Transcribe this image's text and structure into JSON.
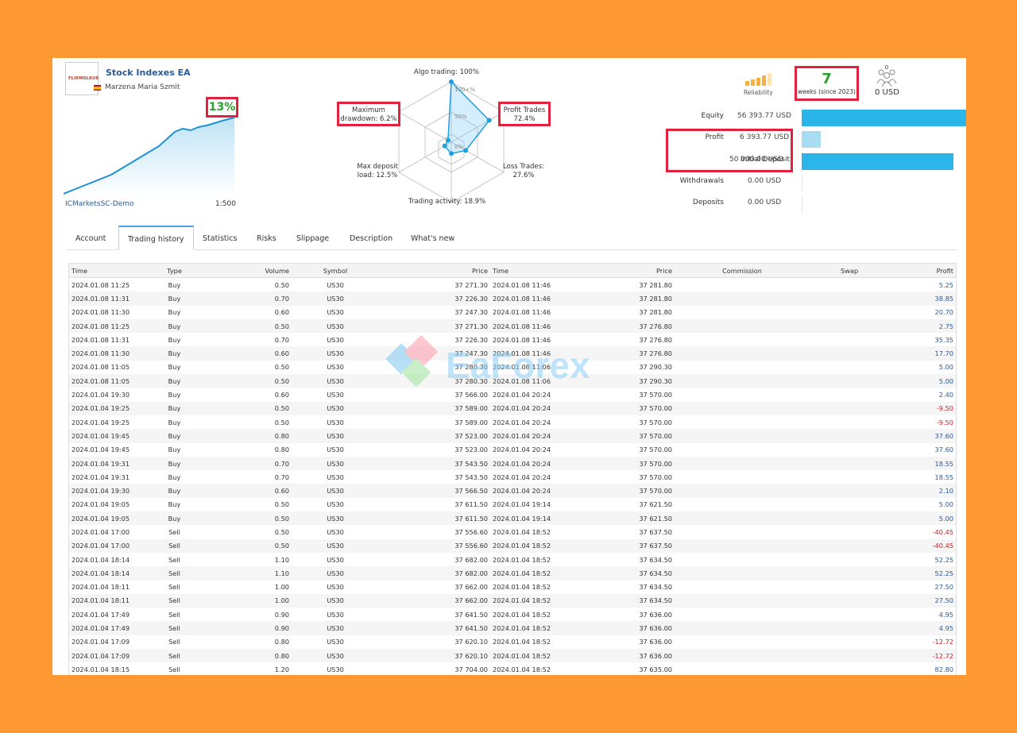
{
  "header": {
    "logo_text": "FLIRMOLBUR",
    "ea_name": "Stock Indexes EA",
    "author": "Marzena Maria Szmit",
    "growth": "13%",
    "server": "ICMarketsSC-Demo",
    "leverage": "1:500"
  },
  "radar": {
    "algo": "Algo trading: 100%",
    "tick100": "100+%",
    "tick50": "50%",
    "tick0": "0%",
    "max_dd_line1": "Maximum",
    "max_dd_line2": "drawdown: 6.2%",
    "profit_trades_line1": "Profit Trades",
    "profit_trades_line2": "72.4%",
    "max_load_line1": "Max deposit",
    "max_load_line2": "load: 12.5%",
    "loss_trades_line1": "Loss Trades:",
    "loss_trades_line2": "27.6%",
    "activity": "Trading activity: 18.9%",
    "values": {
      "algo": 100,
      "profit_trades": 72.4,
      "loss_trades": 27.6,
      "activity": 18.9,
      "max_load": 12.5,
      "max_dd": 6.2
    }
  },
  "reliability": {
    "label": "Reliability"
  },
  "weeks": {
    "value": "7",
    "label": "weeks (since 2023)"
  },
  "subscribers": {
    "count": "0",
    "amount": "0 USD"
  },
  "stats": [
    {
      "label": "Equity",
      "value": "56 393.77 USD",
      "fill": 1.0,
      "color": "#2bb5e8"
    },
    {
      "label": "Profit",
      "value": "6 393.77 USD",
      "fill": 0.113,
      "color": "#a8dcf2"
    },
    {
      "label": "Initial Deposit",
      "value": "50 000.00 USD",
      "fill": 0.887,
      "color": "#2bb5e8"
    },
    {
      "label": "Withdrawals",
      "value": "0.00 USD",
      "fill": 0,
      "color": "#2bb5e8"
    },
    {
      "label": "Deposits",
      "value": "0.00 USD",
      "fill": 0,
      "color": "#2bb5e8"
    }
  ],
  "tabs": [
    "Account",
    "Trading history",
    "Statistics",
    "Risks",
    "Slippage",
    "Description",
    "What's new"
  ],
  "active_tab": 1,
  "watermark": "EaForex",
  "table": {
    "headers": [
      "Time",
      "Type",
      "Volume",
      "Symbol",
      "Price",
      "Time",
      "Price",
      "Commission",
      "Swap",
      "Profit"
    ],
    "rows": [
      [
        "2024.01.08 11:25",
        "Buy",
        "0.50",
        "US30",
        "37 271.30",
        "2024.01.08 11:46",
        "37 281.80",
        "",
        "",
        "5.25"
      ],
      [
        "2024.01.08 11:31",
        "Buy",
        "0.70",
        "US30",
        "37 226.30",
        "2024.01.08 11:46",
        "37 281.80",
        "",
        "",
        "38.85"
      ],
      [
        "2024.01.08 11:30",
        "Buy",
        "0.60",
        "US30",
        "37 247.30",
        "2024.01.08 11:46",
        "37 281.80",
        "",
        "",
        "20.70"
      ],
      [
        "2024.01.08 11:25",
        "Buy",
        "0.50",
        "US30",
        "37 271.30",
        "2024.01.08 11:46",
        "37 276.80",
        "",
        "",
        "2.75"
      ],
      [
        "2024.01.08 11:31",
        "Buy",
        "0.70",
        "US30",
        "37 226.30",
        "2024.01.08 11:46",
        "37 276.80",
        "",
        "",
        "35.35"
      ],
      [
        "2024.01.08 11:30",
        "Buy",
        "0.60",
        "US30",
        "37 247.30",
        "2024.01.08 11:46",
        "37 276.80",
        "",
        "",
        "17.70"
      ],
      [
        "2024.01.08 11:05",
        "Buy",
        "0.50",
        "US30",
        "37 280.30",
        "2024.01.08 11:06",
        "37 290.30",
        "",
        "",
        "5.00"
      ],
      [
        "2024.01.08 11:05",
        "Buy",
        "0.50",
        "US30",
        "37 280.30",
        "2024.01.08 11:06",
        "37 290.30",
        "",
        "",
        "5.00"
      ],
      [
        "2024.01.04 19:30",
        "Buy",
        "0.60",
        "US30",
        "37 566.00",
        "2024.01.04 20:24",
        "37 570.00",
        "",
        "",
        "2.40"
      ],
      [
        "2024.01.04 19:25",
        "Buy",
        "0.50",
        "US30",
        "37 589.00",
        "2024.01.04 20:24",
        "37 570.00",
        "",
        "",
        "-9.50"
      ],
      [
        "2024.01.04 19:25",
        "Buy",
        "0.50",
        "US30",
        "37 589.00",
        "2024.01.04 20:24",
        "37 570.00",
        "",
        "",
        "-9.50"
      ],
      [
        "2024.01.04 19:45",
        "Buy",
        "0.80",
        "US30",
        "37 523.00",
        "2024.01.04 20:24",
        "37 570.00",
        "",
        "",
        "37.60"
      ],
      [
        "2024.01.04 19:45",
        "Buy",
        "0.80",
        "US30",
        "37 523.00",
        "2024.01.04 20:24",
        "37 570.00",
        "",
        "",
        "37.60"
      ],
      [
        "2024.01.04 19:31",
        "Buy",
        "0.70",
        "US30",
        "37 543.50",
        "2024.01.04 20:24",
        "37 570.00",
        "",
        "",
        "18.55"
      ],
      [
        "2024.01.04 19:31",
        "Buy",
        "0.70",
        "US30",
        "37 543.50",
        "2024.01.04 20:24",
        "37 570.00",
        "",
        "",
        "18.55"
      ],
      [
        "2024.01.04 19:30",
        "Buy",
        "0.60",
        "US30",
        "37 566.50",
        "2024.01.04 20:24",
        "37 570.00",
        "",
        "",
        "2.10"
      ],
      [
        "2024.01.04 19:05",
        "Buy",
        "0.50",
        "US30",
        "37 611.50",
        "2024.01.04 19:14",
        "37 621.50",
        "",
        "",
        "5.00"
      ],
      [
        "2024.01.04 19:05",
        "Buy",
        "0.50",
        "US30",
        "37 611.50",
        "2024.01.04 19:14",
        "37 621.50",
        "",
        "",
        "5.00"
      ],
      [
        "2024.01.04 17:00",
        "Sell",
        "0.50",
        "US30",
        "37 556.60",
        "2024.01.04 18:52",
        "37 637.50",
        "",
        "",
        "-40.45"
      ],
      [
        "2024.01.04 17:00",
        "Sell",
        "0.50",
        "US30",
        "37 556.60",
        "2024.01.04 18:52",
        "37 637.50",
        "",
        "",
        "-40.45"
      ],
      [
        "2024.01.04 18:14",
        "Sell",
        "1.10",
        "US30",
        "37 682.00",
        "2024.01.04 18:52",
        "37 634.50",
        "",
        "",
        "52.25"
      ],
      [
        "2024.01.04 18:14",
        "Sell",
        "1.10",
        "US30",
        "37 682.00",
        "2024.01.04 18:52",
        "37 634.50",
        "",
        "",
        "52.25"
      ],
      [
        "2024.01.04 18:11",
        "Sell",
        "1.00",
        "US30",
        "37 662.00",
        "2024.01.04 18:52",
        "37 634.50",
        "",
        "",
        "27.50"
      ],
      [
        "2024.01.04 18:11",
        "Sell",
        "1.00",
        "US30",
        "37 662.00",
        "2024.01.04 18:52",
        "37 634.50",
        "",
        "",
        "27.50"
      ],
      [
        "2024.01.04 17:49",
        "Sell",
        "0.90",
        "US30",
        "37 641.50",
        "2024.01.04 18:52",
        "37 636.00",
        "",
        "",
        "4.95"
      ],
      [
        "2024.01.04 17:49",
        "Sell",
        "0.90",
        "US30",
        "37 641.50",
        "2024.01.04 18:52",
        "37 636.00",
        "",
        "",
        "4.95"
      ],
      [
        "2024.01.04 17:09",
        "Sell",
        "0.80",
        "US30",
        "37 620.10",
        "2024.01.04 18:52",
        "37 636.00",
        "",
        "",
        "-12.72"
      ],
      [
        "2024.01.04 17:09",
        "Sell",
        "0.80",
        "US30",
        "37 620.10",
        "2024.01.04 18:52",
        "37 636.00",
        "",
        "",
        "-12.72"
      ],
      [
        "2024.01.04 18:15",
        "Sell",
        "1.20",
        "US30",
        "37 704.00",
        "2024.01.04 18:52",
        "37 635.00",
        "",
        "",
        "82.80"
      ]
    ]
  }
}
